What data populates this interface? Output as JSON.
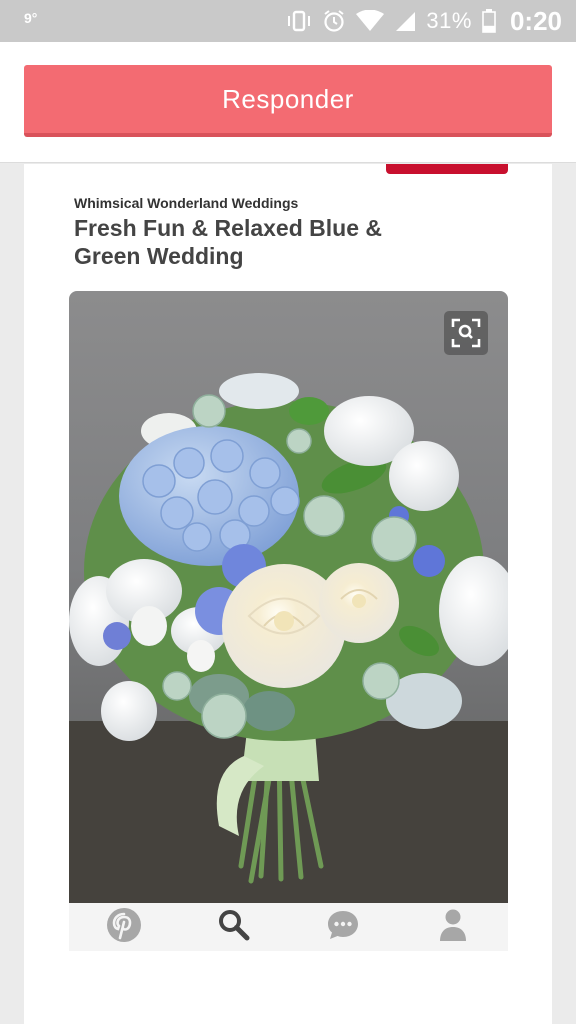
{
  "status_bar": {
    "temperature": "9°",
    "battery_percent": "31%",
    "time": "0:20",
    "battery_level": 0.31,
    "icons": [
      "vibrate-icon",
      "alarm-icon",
      "wifi-icon",
      "signal-icon",
      "battery-icon"
    ]
  },
  "header": {
    "reply_label": "Responder"
  },
  "pin": {
    "source": "Whimsical Wonderland Weddings",
    "title": "Fresh Fun & Relaxed Blue & Green Wedding",
    "image_subject": "blue and white wedding bouquet",
    "icons": [
      "zoom-icon"
    ]
  },
  "nav": {
    "items": [
      "pinterest-icon",
      "search-icon",
      "chat-icon",
      "profile-icon"
    ]
  },
  "colors": {
    "accent": "#f36b72",
    "pinterest_red": "#c8102e",
    "status_bar": "#c9c9c9"
  }
}
